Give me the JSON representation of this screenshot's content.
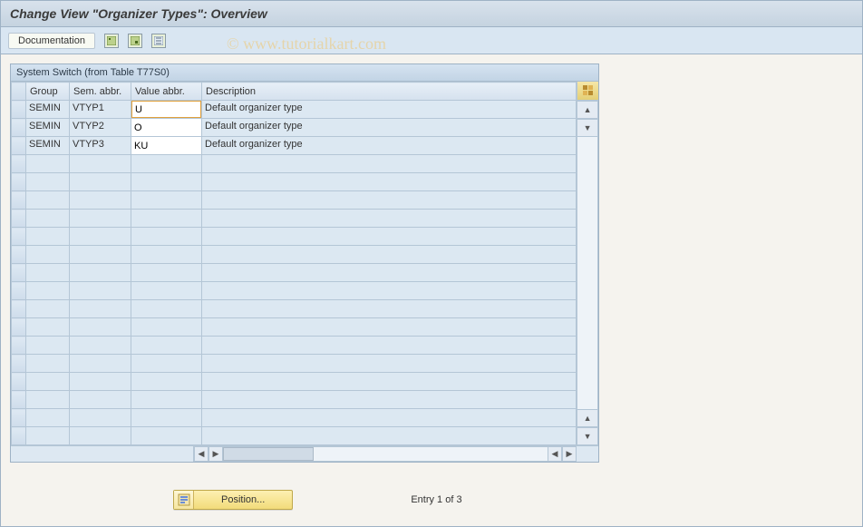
{
  "title": "Change View \"Organizer Types\": Overview",
  "toolbar": {
    "documentation_label": "Documentation"
  },
  "watermark": "© www.tutorialkart.com",
  "panel": {
    "title": "System Switch (from Table T77S0)",
    "columns": {
      "group": "Group",
      "sem": "Sem. abbr.",
      "val": "Value abbr.",
      "desc": "Description"
    },
    "rows": [
      {
        "group": "SEMIN",
        "sem": "VTYP1",
        "val": "U",
        "desc": "Default organizer type"
      },
      {
        "group": "SEMIN",
        "sem": "VTYP2",
        "val": "O",
        "desc": "Default organizer type"
      },
      {
        "group": "SEMIN",
        "sem": "VTYP3",
        "val": "KU",
        "desc": "Default organizer type"
      }
    ]
  },
  "footer": {
    "position_label": "Position...",
    "entry_label": "Entry 1 of 3"
  }
}
